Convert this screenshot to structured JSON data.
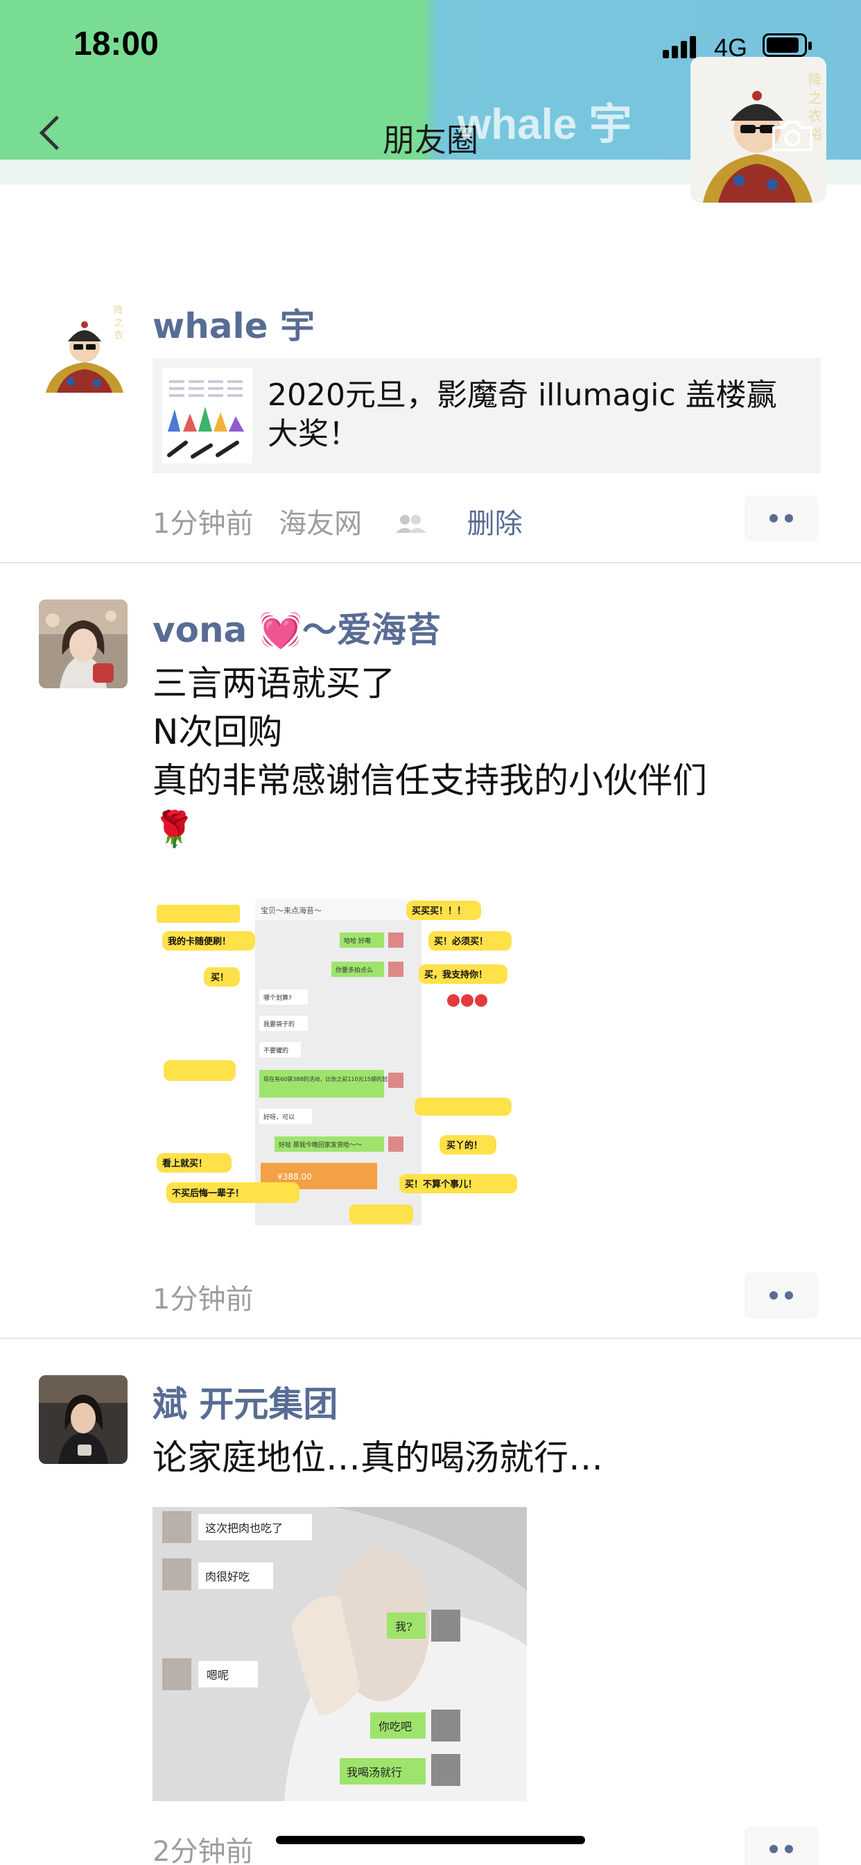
{
  "status_bar": {
    "time": "18:00",
    "network": "4G"
  },
  "header": {
    "title": "朋友圈",
    "cover_name": "whale 宇"
  },
  "posts": [
    {
      "name": "whale 宇",
      "link": {
        "title": "2020元旦，影魔奇 illumagic 盖楼赢大奖！"
      },
      "time": "1分钟前",
      "source": "海友网",
      "delete_label": "删除"
    },
    {
      "name": "vona 💓～爱海苔",
      "lines": [
        "三言两语就买了",
        "N次回购",
        "真的非常感谢信任支持我的小伙伴们",
        "🌹"
      ],
      "time": "1分钟前",
      "image": {
        "stickers": [
          "买买买！！！",
          "我的卡随便刷！",
          "买！必须买！",
          "买！",
          "买，我支持你！",
          "看上就买！",
          "不买后悔一辈子！",
          "买丫的！",
          "买！不算个事儿！"
        ],
        "title": "宝贝～来点海苔～",
        "bubbles": [
          "哈哈 好嘞",
          "你要多拍点么",
          "哪个划算?",
          "我要袋子的",
          "不要罐的",
          "现在有60袋388的活动，比你之前110元15袋的划算更多",
          "好呀，可以",
          "好哒 那我今晚回家发货哈～～",
          "¥388.00"
        ]
      }
    },
    {
      "name": "斌 开元集团",
      "lines": [
        "论家庭地位…真的喝汤就行…"
      ],
      "time": "2分钟前",
      "image": {
        "bubbles": [
          "这次把肉也吃了",
          "肉很好吃",
          "我?",
          "嗯呢",
          "你吃吧",
          "我喝汤就行"
        ]
      }
    }
  ]
}
